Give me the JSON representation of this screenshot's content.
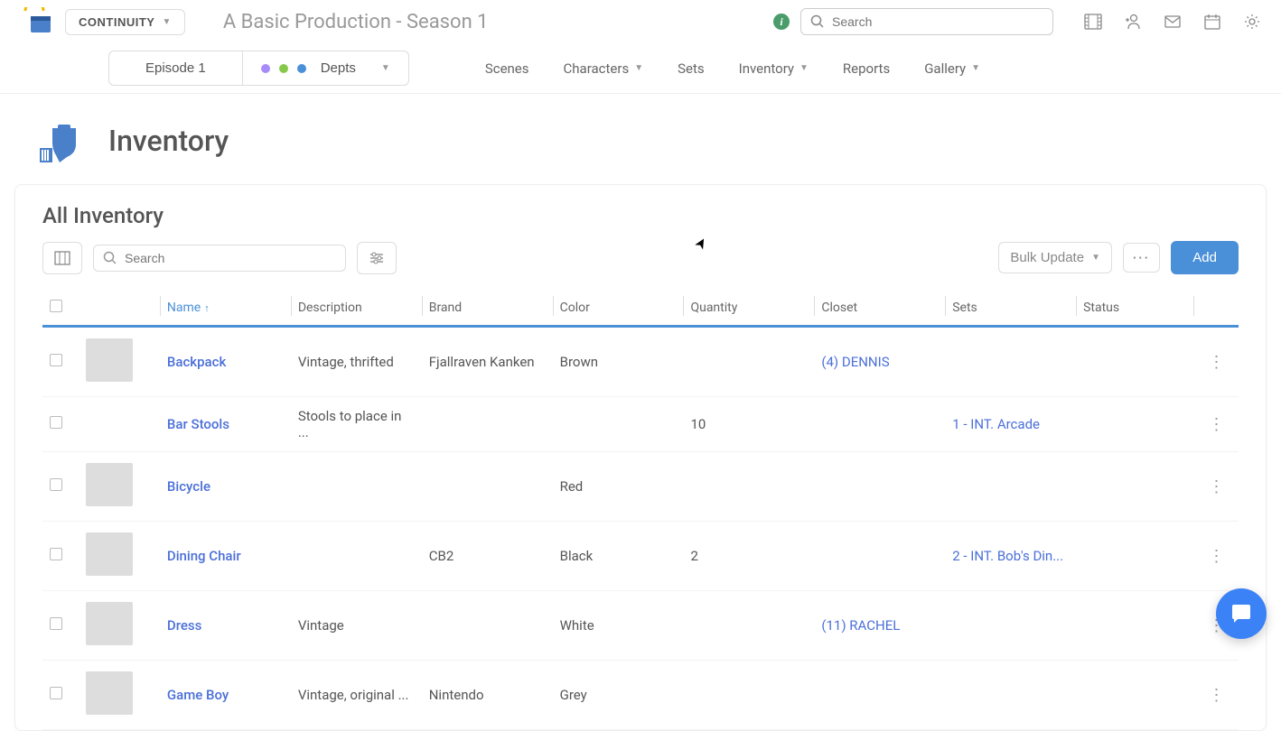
{
  "header": {
    "continuity_label": "CONTINUITY",
    "production_title": "A Basic Production - Season 1",
    "search_placeholder": "Search"
  },
  "nav": {
    "episode_label": "Episode 1",
    "depts_label": "Depts",
    "scenes": "Scenes",
    "characters": "Characters",
    "sets": "Sets",
    "inventory": "Inventory",
    "reports": "Reports",
    "gallery": "Gallery"
  },
  "page": {
    "title": "Inventory",
    "panel_title": "All Inventory",
    "search_placeholder": "Search",
    "bulk_update": "Bulk Update",
    "add": "Add"
  },
  "columns": {
    "name": "Name",
    "description": "Description",
    "brand": "Brand",
    "color": "Color",
    "quantity": "Quantity",
    "closet": "Closet",
    "sets": "Sets",
    "status": "Status"
  },
  "rows": [
    {
      "name": "Backpack",
      "description": "Vintage, thrifted",
      "brand": "Fjallraven Kanken",
      "color": "Brown",
      "quantity": "",
      "closet": "(4) DENNIS",
      "sets": "",
      "thumb": true
    },
    {
      "name": "Bar Stools",
      "description": "Stools to place in ...",
      "brand": "",
      "color": "",
      "quantity": "10",
      "closet": "",
      "sets": "1 - INT. Arcade",
      "thumb": false
    },
    {
      "name": "Bicycle",
      "description": "",
      "brand": "",
      "color": "Red",
      "quantity": "",
      "closet": "",
      "sets": "",
      "thumb": true
    },
    {
      "name": "Dining Chair",
      "description": "",
      "brand": "CB2",
      "color": "Black",
      "quantity": "2",
      "closet": "",
      "sets": "2 - INT. Bob's Din...",
      "thumb": true
    },
    {
      "name": "Dress",
      "description": "Vintage",
      "brand": "",
      "color": "White",
      "quantity": "",
      "closet": "(11) RACHEL",
      "sets": "",
      "thumb": true
    },
    {
      "name": "Game Boy",
      "description": "Vintage, original ...",
      "brand": "Nintendo",
      "color": "Grey",
      "quantity": "",
      "closet": "",
      "sets": "",
      "thumb": true
    }
  ]
}
